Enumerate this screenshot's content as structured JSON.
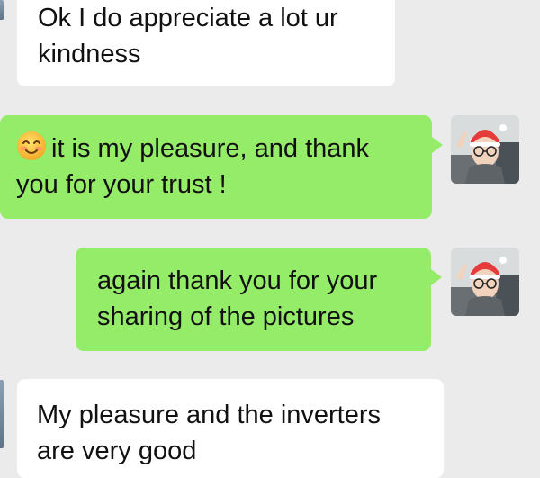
{
  "messages": [
    {
      "direction": "incoming",
      "lines": [
        "Ok I do appreciate a lot ur",
        "kindness"
      ]
    },
    {
      "direction": "outgoing",
      "emoji": "smiling-face-emoji",
      "lines": [
        "it is my pleasure, and thank",
        "you for your trust !"
      ],
      "avatar": "user-avatar"
    },
    {
      "direction": "outgoing",
      "lines": [
        "again thank you for your",
        "sharing of the pictures"
      ],
      "avatar": "user-avatar"
    },
    {
      "direction": "incoming",
      "lines": [
        "My pleasure and the inverters",
        "are very good"
      ]
    }
  ],
  "colors": {
    "background": "#ebebeb",
    "incoming_bubble": "#ffffff",
    "outgoing_bubble": "#95ec69"
  }
}
